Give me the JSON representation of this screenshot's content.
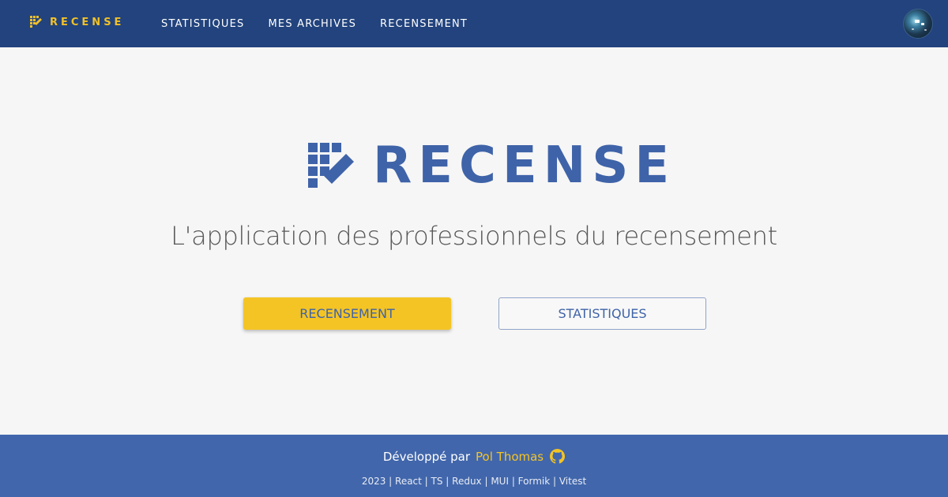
{
  "colors": {
    "navbar_bg": "#22437d",
    "brand_yellow": "#f4c425",
    "brand_blue": "#3f63a8",
    "footer_bg": "#4166ab",
    "page_bg": "#f6f6f6"
  },
  "header": {
    "brand_icon": "census-grid-pencil-icon",
    "brand_name": "RECENSE",
    "nav": [
      {
        "label": "STATISTIQUES"
      },
      {
        "label": "MES ARCHIVES"
      },
      {
        "label": "RECENSEMENT"
      }
    ],
    "avatar_icon": "user-avatar"
  },
  "hero": {
    "logo_icon": "census-grid-pencil-icon",
    "title": "RECENSE",
    "tagline": "L'application des professionnels du recensement",
    "primary_button": "RECENSEMENT",
    "secondary_button": "STATISTIQUES"
  },
  "footer": {
    "credit_prefix": "Développé par",
    "author": "Pol Thomas",
    "author_icon": "github-icon",
    "stack": "2023 | React | TS | Redux | MUI | Formik | Vitest"
  }
}
